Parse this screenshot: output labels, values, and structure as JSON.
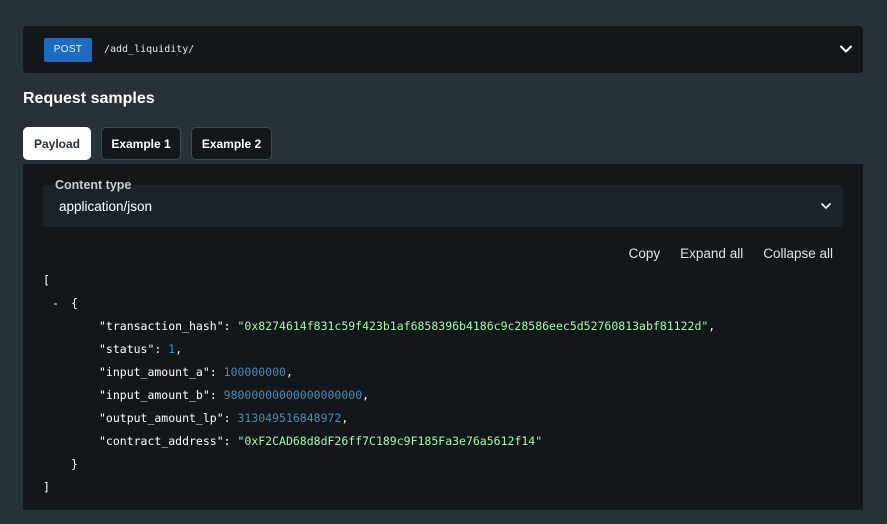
{
  "endpoint": {
    "method": "POST",
    "path": "/add_liquidity/"
  },
  "section_title": "Request samples",
  "tabs": [
    {
      "label": "Payload"
    },
    {
      "label": "Example 1"
    },
    {
      "label": "Example 2"
    }
  ],
  "content_type": {
    "label": "Content type",
    "value": "application/json"
  },
  "actions": {
    "copy": "Copy",
    "expand": "Expand all",
    "collapse": "Collapse all"
  },
  "payload": {
    "open_bracket": "[",
    "collapse_toggle": "-",
    "open_brace": "{",
    "close_brace": "}",
    "close_bracket": "]",
    "fields": [
      {
        "key": "\"transaction_hash\"",
        "value": "\"0x8274614f831c59f423b1af6858396b4186c9c28586eec5d52760813abf81122d\"",
        "type": "string",
        "trail": ","
      },
      {
        "key": "\"status\"",
        "value": "1",
        "type": "number",
        "trail": ","
      },
      {
        "key": "\"input_amount_a\"",
        "value": "100000000",
        "type": "number",
        "trail": ","
      },
      {
        "key": "\"input_amount_b\"",
        "value": "98000000000000000000",
        "type": "number",
        "trail": ","
      },
      {
        "key": "\"output_amount_lp\"",
        "value": "313049516848972",
        "type": "number",
        "trail": ","
      },
      {
        "key": "\"contract_address\"",
        "value": "\"0xF2CAD68d8dF26ff7C189c9F185Fa3e76a5612f14\"",
        "type": "string",
        "trail": ""
      }
    ]
  }
}
